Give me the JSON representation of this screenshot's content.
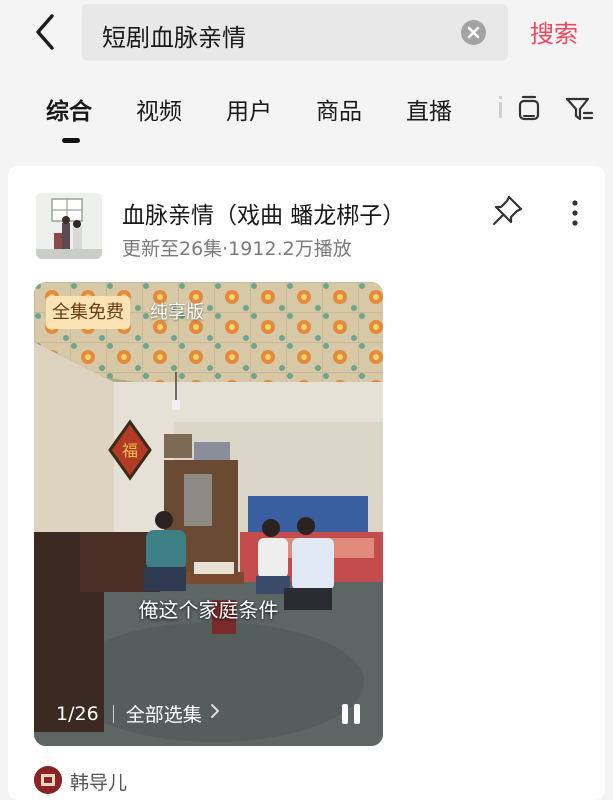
{
  "search": {
    "query": "短剧血脉亲情",
    "submit_label": "搜索"
  },
  "tabs": [
    {
      "label": "综合",
      "active": true
    },
    {
      "label": "视频",
      "active": false
    },
    {
      "label": "用户",
      "active": false
    },
    {
      "label": "商品",
      "active": false
    },
    {
      "label": "直播",
      "active": false
    }
  ],
  "icons": {
    "back": "back-arrow-icon",
    "clear": "clear-x-icon",
    "tv": "tv-icon",
    "filter": "filter-icon",
    "pin": "pin-icon",
    "more": "more-vertical-icon",
    "pause": "pause-icon",
    "chevron": "chevron-right-icon"
  },
  "result": {
    "title": "血脉亲情（戏曲 蟠龙梆子）",
    "meta": "更新至26集·1912.2万播放",
    "badge_free": "全集免费",
    "badge_pure": "纯享版",
    "caption": "俺这个家庭条件",
    "episode_counter": "1/26",
    "episode_select": "全部选集",
    "author": "韩导儿"
  },
  "colors": {
    "accent": "#e94a5f",
    "badge_bg": "#fbe3b6",
    "badge_text": "#6b3f12",
    "background": "#f4f4f4"
  }
}
